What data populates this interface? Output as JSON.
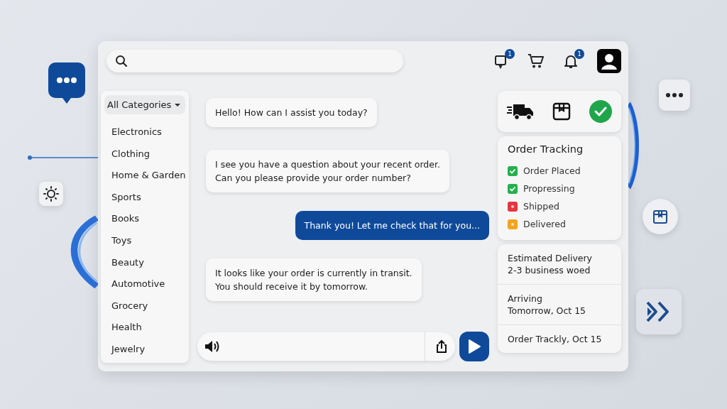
{
  "header": {
    "badges": [
      {
        "kind": "notification",
        "count": "1"
      },
      {
        "kind": "cart"
      },
      {
        "kind": "bell",
        "count": "1"
      },
      {
        "kind": "avatar"
      }
    ]
  },
  "sidebar": {
    "dropdown": "All Categories",
    "items": [
      "Electronics",
      "Clothing",
      "Home & Garden",
      "Sports",
      "Books",
      "Toys",
      "Beauty",
      "Automotive",
      "Grocery",
      "Health",
      "Jewelry"
    ]
  },
  "chat": {
    "messages": [
      {
        "kind": "agent",
        "text": "Hello! How can I assist you today?"
      },
      {
        "kind": "agent",
        "text": "I see you have a question about your recent order.\nCan you please provide your order number?"
      },
      {
        "kind": "user",
        "text": "Thank you! Let me check that for you..."
      },
      {
        "kind": "agent",
        "text": "It looks like your order is currently in transit.\nYou should receive it by tomorrow."
      }
    ]
  },
  "tracking": {
    "title": "Order Tracking",
    "steps": [
      {
        "label": "Order Placed",
        "done": true,
        "color": "#22b14c"
      },
      {
        "label": "Propressing",
        "done": true,
        "color": "#22b14c"
      },
      {
        "label": "Shipped",
        "done": false,
        "color": "#e8363f"
      },
      {
        "label": "Delivered",
        "done": false,
        "color": "#f5a31a"
      }
    ]
  },
  "delivery": [
    {
      "label": "Estimated Delivery",
      "value": "2-3 business woed"
    },
    {
      "label": "Arriving",
      "value": "Tomorrow, Oct 15"
    },
    {
      "label": "Order Trackly, Oct 15"
    }
  ]
}
